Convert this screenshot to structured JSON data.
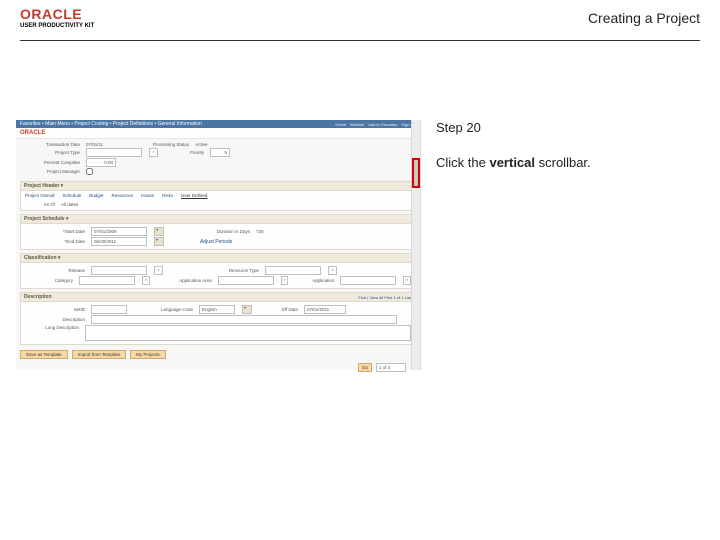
{
  "header": {
    "brand_word": "ORACLE",
    "brand_sub": "USER PRODUCTIVITY KIT",
    "title": "Creating a Project"
  },
  "instruction": {
    "step_label": "Step 20",
    "line_pre": "Click the ",
    "line_bold": "vertical",
    "line_post": " scrollbar."
  },
  "app": {
    "breadcrumb": "Favorites  •  Main Menu  •  Project Costing  •  Project Definitions  •  General Information",
    "toplinks": [
      "Home",
      "Worklist",
      "Add to Favorites",
      "Sign out"
    ],
    "brand": "ORACLE",
    "fields": {
      "transaction": {
        "label": "Transaction Date",
        "value": "07/01/11"
      },
      "status": {
        "label": "Processing Status",
        "value": "Active"
      },
      "project_type": {
        "label": "Project Type",
        "value": ""
      },
      "priority": {
        "label": "Priority",
        "value": "5"
      },
      "percent": {
        "label": "Percent Complete",
        "value": "0.00"
      },
      "manager": {
        "label": "Project Manager",
        "value": ""
      }
    },
    "tabs": [
      "Project Overall",
      "Schedule",
      "Budget",
      "Resources",
      "Issues",
      "Risks",
      "User Defined"
    ],
    "header_section": {
      "title": "Project Header ▾",
      "asof": {
        "label": "As Of",
        "value": "All dates"
      }
    },
    "schedule": {
      "title": "Project Schedule ▾",
      "start": {
        "label": "*Start Date",
        "value": "07/01/2009"
      },
      "end": {
        "label": "*End Date",
        "value": "06/30/2011"
      },
      "duration": {
        "label": "Duration in Days",
        "value": "730"
      },
      "adjust": "Adjust Periods"
    },
    "classification": {
      "title": "Classification ▾",
      "release": {
        "label": "Release",
        "value": ""
      },
      "resource_type": {
        "label": "Resource Type",
        "value": ""
      },
      "category": {
        "label": "Category",
        "value": ""
      },
      "application": {
        "label": "Application",
        "value": ""
      },
      "application_area": {
        "label": "Application Area",
        "value": ""
      }
    },
    "description": {
      "title": "Description",
      "hint": "Find | View All   First 1 of 1 Last",
      "set": {
        "label": "SetID",
        "value": ""
      },
      "lang": {
        "label": "Language Code",
        "value": "English"
      },
      "eff": {
        "label": "Eff Date",
        "value": "07/01/2011"
      },
      "long": {
        "label": "Description",
        "value": ""
      },
      "long2": {
        "label": "Long Description",
        "value": ""
      }
    },
    "buttons": [
      "Save as Template",
      "Import from Template",
      "My Projects"
    ],
    "footer": {
      "go": "Go",
      "page": "1 of 2"
    }
  }
}
